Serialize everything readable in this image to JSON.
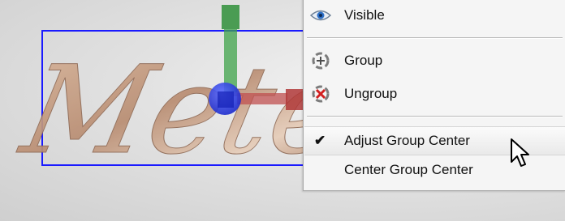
{
  "menu": {
    "items": [
      {
        "label": "Visible",
        "icon": "eye-icon",
        "checked": false
      },
      {
        "label": "Group",
        "icon": "group-icon",
        "checked": false
      },
      {
        "label": "Ungroup",
        "icon": "ungroup-icon",
        "checked": false
      },
      {
        "label": "Adjust Group Center",
        "icon": "",
        "checked": true
      },
      {
        "label": "Center Group Center",
        "icon": "",
        "checked": false
      }
    ],
    "check_mark": "✔"
  },
  "canvas": {
    "text_object": "Mete",
    "selection_color": "#1a1aff",
    "gizmo_x_color": "#c05050",
    "gizmo_y_color": "#3fa34a",
    "gizmo_center_color": "#1f2fe0"
  }
}
